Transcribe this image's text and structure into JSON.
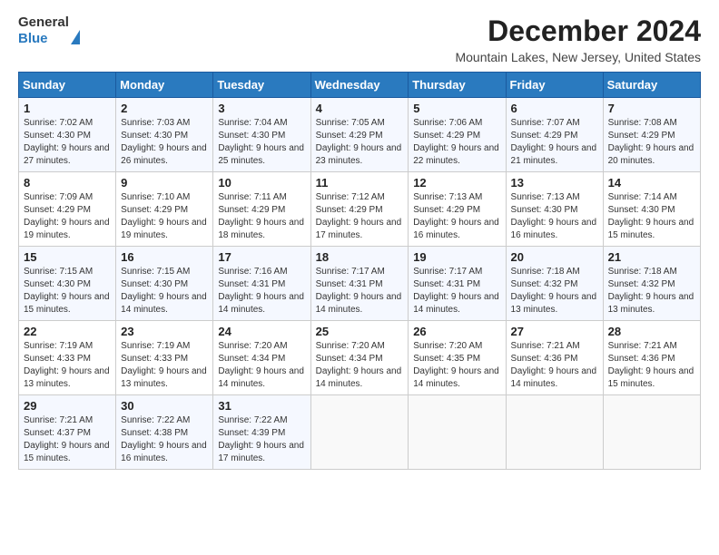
{
  "header": {
    "logo_general": "General",
    "logo_blue": "Blue",
    "title": "December 2024",
    "subtitle": "Mountain Lakes, New Jersey, United States"
  },
  "weekdays": [
    "Sunday",
    "Monday",
    "Tuesday",
    "Wednesday",
    "Thursday",
    "Friday",
    "Saturday"
  ],
  "weeks": [
    [
      {
        "day": "1",
        "info": "Sunrise: 7:02 AM\nSunset: 4:30 PM\nDaylight: 9 hours and 27 minutes."
      },
      {
        "day": "2",
        "info": "Sunrise: 7:03 AM\nSunset: 4:30 PM\nDaylight: 9 hours and 26 minutes."
      },
      {
        "day": "3",
        "info": "Sunrise: 7:04 AM\nSunset: 4:30 PM\nDaylight: 9 hours and 25 minutes."
      },
      {
        "day": "4",
        "info": "Sunrise: 7:05 AM\nSunset: 4:29 PM\nDaylight: 9 hours and 23 minutes."
      },
      {
        "day": "5",
        "info": "Sunrise: 7:06 AM\nSunset: 4:29 PM\nDaylight: 9 hours and 22 minutes."
      },
      {
        "day": "6",
        "info": "Sunrise: 7:07 AM\nSunset: 4:29 PM\nDaylight: 9 hours and 21 minutes."
      },
      {
        "day": "7",
        "info": "Sunrise: 7:08 AM\nSunset: 4:29 PM\nDaylight: 9 hours and 20 minutes."
      }
    ],
    [
      {
        "day": "8",
        "info": "Sunrise: 7:09 AM\nSunset: 4:29 PM\nDaylight: 9 hours and 19 minutes."
      },
      {
        "day": "9",
        "info": "Sunrise: 7:10 AM\nSunset: 4:29 PM\nDaylight: 9 hours and 19 minutes."
      },
      {
        "day": "10",
        "info": "Sunrise: 7:11 AM\nSunset: 4:29 PM\nDaylight: 9 hours and 18 minutes."
      },
      {
        "day": "11",
        "info": "Sunrise: 7:12 AM\nSunset: 4:29 PM\nDaylight: 9 hours and 17 minutes."
      },
      {
        "day": "12",
        "info": "Sunrise: 7:13 AM\nSunset: 4:29 PM\nDaylight: 9 hours and 16 minutes."
      },
      {
        "day": "13",
        "info": "Sunrise: 7:13 AM\nSunset: 4:30 PM\nDaylight: 9 hours and 16 minutes."
      },
      {
        "day": "14",
        "info": "Sunrise: 7:14 AM\nSunset: 4:30 PM\nDaylight: 9 hours and 15 minutes."
      }
    ],
    [
      {
        "day": "15",
        "info": "Sunrise: 7:15 AM\nSunset: 4:30 PM\nDaylight: 9 hours and 15 minutes."
      },
      {
        "day": "16",
        "info": "Sunrise: 7:15 AM\nSunset: 4:30 PM\nDaylight: 9 hours and 14 minutes."
      },
      {
        "day": "17",
        "info": "Sunrise: 7:16 AM\nSunset: 4:31 PM\nDaylight: 9 hours and 14 minutes."
      },
      {
        "day": "18",
        "info": "Sunrise: 7:17 AM\nSunset: 4:31 PM\nDaylight: 9 hours and 14 minutes."
      },
      {
        "day": "19",
        "info": "Sunrise: 7:17 AM\nSunset: 4:31 PM\nDaylight: 9 hours and 14 minutes."
      },
      {
        "day": "20",
        "info": "Sunrise: 7:18 AM\nSunset: 4:32 PM\nDaylight: 9 hours and 13 minutes."
      },
      {
        "day": "21",
        "info": "Sunrise: 7:18 AM\nSunset: 4:32 PM\nDaylight: 9 hours and 13 minutes."
      }
    ],
    [
      {
        "day": "22",
        "info": "Sunrise: 7:19 AM\nSunset: 4:33 PM\nDaylight: 9 hours and 13 minutes."
      },
      {
        "day": "23",
        "info": "Sunrise: 7:19 AM\nSunset: 4:33 PM\nDaylight: 9 hours and 13 minutes."
      },
      {
        "day": "24",
        "info": "Sunrise: 7:20 AM\nSunset: 4:34 PM\nDaylight: 9 hours and 14 minutes."
      },
      {
        "day": "25",
        "info": "Sunrise: 7:20 AM\nSunset: 4:34 PM\nDaylight: 9 hours and 14 minutes."
      },
      {
        "day": "26",
        "info": "Sunrise: 7:20 AM\nSunset: 4:35 PM\nDaylight: 9 hours and 14 minutes."
      },
      {
        "day": "27",
        "info": "Sunrise: 7:21 AM\nSunset: 4:36 PM\nDaylight: 9 hours and 14 minutes."
      },
      {
        "day": "28",
        "info": "Sunrise: 7:21 AM\nSunset: 4:36 PM\nDaylight: 9 hours and 15 minutes."
      }
    ],
    [
      {
        "day": "29",
        "info": "Sunrise: 7:21 AM\nSunset: 4:37 PM\nDaylight: 9 hours and 15 minutes."
      },
      {
        "day": "30",
        "info": "Sunrise: 7:22 AM\nSunset: 4:38 PM\nDaylight: 9 hours and 16 minutes."
      },
      {
        "day": "31",
        "info": "Sunrise: 7:22 AM\nSunset: 4:39 PM\nDaylight: 9 hours and 17 minutes."
      },
      null,
      null,
      null,
      null
    ]
  ]
}
